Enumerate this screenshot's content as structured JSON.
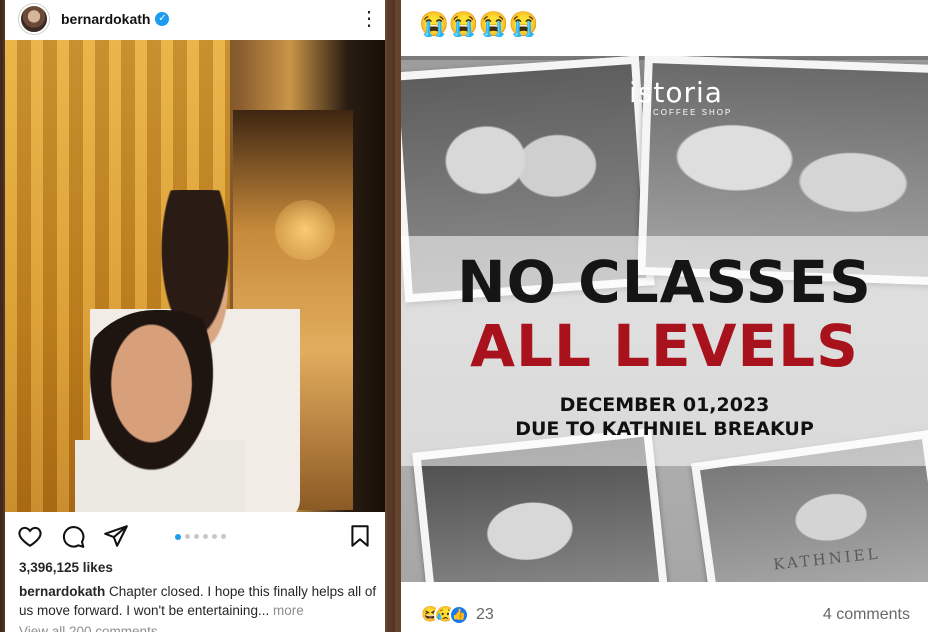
{
  "instagram": {
    "username": "bernardokath",
    "more_icon": "⋮",
    "likes": "3,396,125 likes",
    "caption_user": "bernardokath",
    "caption_text": " Chapter closed. I hope this finally helps all of us move forward. I won't be entertaining...",
    "caption_more": " more",
    "view_comments": "View all 200 comments",
    "carousel_count": 6,
    "carousel_active": 0,
    "icons": [
      "heart-icon",
      "comment-icon",
      "share-icon",
      "bookmark-icon"
    ]
  },
  "facebook": {
    "top_emojis": "😭😭😭😭",
    "poster": {
      "brand": "istoria",
      "brand_sub": "COFFEE SHOP",
      "headline_1": "NO CLASSES",
      "headline_2": "ALL LEVELS",
      "sub_1": "DECEMBER 01,2023",
      "sub_2": "DUE TO KATHNIEL BREAKUP",
      "stamp": "KATHNIEL",
      "colors": {
        "headline_dark": "#151515",
        "headline_red": "#a8121c"
      }
    },
    "reactions": {
      "haha": "😆",
      "sad": "😥",
      "like": "👍",
      "count": "23"
    },
    "comments_count": "4 comments",
    "colors": {
      "like_blue": "#1877f2",
      "meta_gray": "#65676b"
    }
  }
}
